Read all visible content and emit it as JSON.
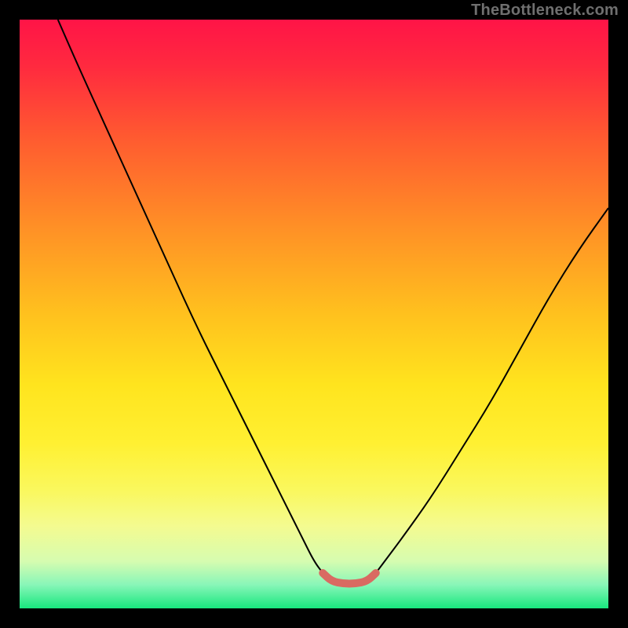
{
  "watermark": "TheBottleneck.com",
  "chart_data": {
    "type": "line",
    "title": "",
    "xlabel": "",
    "ylabel": "",
    "xlim": [
      0,
      100
    ],
    "ylim": [
      0,
      100
    ],
    "grid": false,
    "legend": false,
    "background": {
      "type": "vertical-gradient",
      "stops": [
        {
          "pos": 0.0,
          "color": "#ff1447"
        },
        {
          "pos": 0.08,
          "color": "#ff2a3f"
        },
        {
          "pos": 0.2,
          "color": "#ff5a30"
        },
        {
          "pos": 0.35,
          "color": "#ff8f26"
        },
        {
          "pos": 0.5,
          "color": "#ffc11e"
        },
        {
          "pos": 0.62,
          "color": "#ffe41e"
        },
        {
          "pos": 0.72,
          "color": "#fff032"
        },
        {
          "pos": 0.8,
          "color": "#faf85e"
        },
        {
          "pos": 0.86,
          "color": "#f4fb90"
        },
        {
          "pos": 0.92,
          "color": "#d6fcb0"
        },
        {
          "pos": 0.96,
          "color": "#88f6b8"
        },
        {
          "pos": 1.0,
          "color": "#18e77e"
        }
      ]
    },
    "series": [
      {
        "name": "bottleneck-curve-left",
        "stroke": "#000000",
        "stroke_width": 2,
        "x": [
          6.5,
          10,
          15,
          20,
          25,
          30,
          35,
          40,
          45,
          48,
          50,
          51.5
        ],
        "y": [
          100,
          92,
          81,
          70,
          59,
          48,
          38,
          28,
          18,
          12,
          8,
          6
        ]
      },
      {
        "name": "bottleneck-curve-right",
        "stroke": "#000000",
        "stroke_width": 2,
        "x": [
          60.5,
          62,
          65,
          70,
          75,
          80,
          85,
          90,
          95,
          100
        ],
        "y": [
          6,
          8,
          12,
          19,
          27,
          35,
          44,
          53,
          61,
          68
        ]
      },
      {
        "name": "sweet-spot-band",
        "stroke": "#d96a62",
        "stroke_width": 10,
        "stroke_linecap": "round",
        "x": [
          51.5,
          53,
          55,
          57,
          59,
          60.5
        ],
        "y": [
          6,
          4.6,
          4.2,
          4.2,
          4.6,
          6
        ]
      }
    ],
    "annotations": []
  }
}
